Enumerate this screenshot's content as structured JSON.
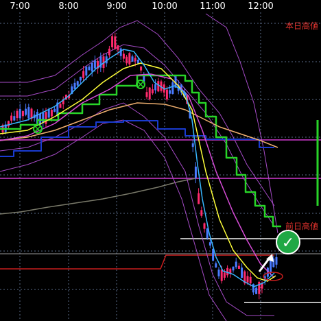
{
  "chart_data": {
    "type": "line",
    "subtype": "candlestick-with-indicators",
    "x_tick_labels": [
      "7:00",
      "8:00",
      "9:00",
      "10:00",
      "11:00",
      "12:00"
    ],
    "annotations": {
      "today_high_label": "本日高値",
      "prev_day_high_label": "前日高値",
      "check_mark": "✓"
    },
    "colors": {
      "background": "#000000",
      "grid": "#5a6b8a",
      "bull_candle": "#ff2a6d",
      "bear_candle": "#4a7bff",
      "ma_fast": "#37b6ff",
      "ma_mid": "#ffff3a",
      "ma_slow": "#d64bd6",
      "ma_long": "#f0b070",
      "bollinger": "#a64bc8",
      "step_green": "#28d428",
      "step_blue": "#1a3bd0",
      "step_gray": "#7a7a6a",
      "horizontal_magenta": "#d23ad2",
      "horizontal_white": "#f4f4f4",
      "horizontal_red": "#c81e1e",
      "label_red": "#e0322d",
      "arrow": "#ffffff",
      "check_bg": "#1fa845"
    },
    "grid": true,
    "legend": "none"
  }
}
